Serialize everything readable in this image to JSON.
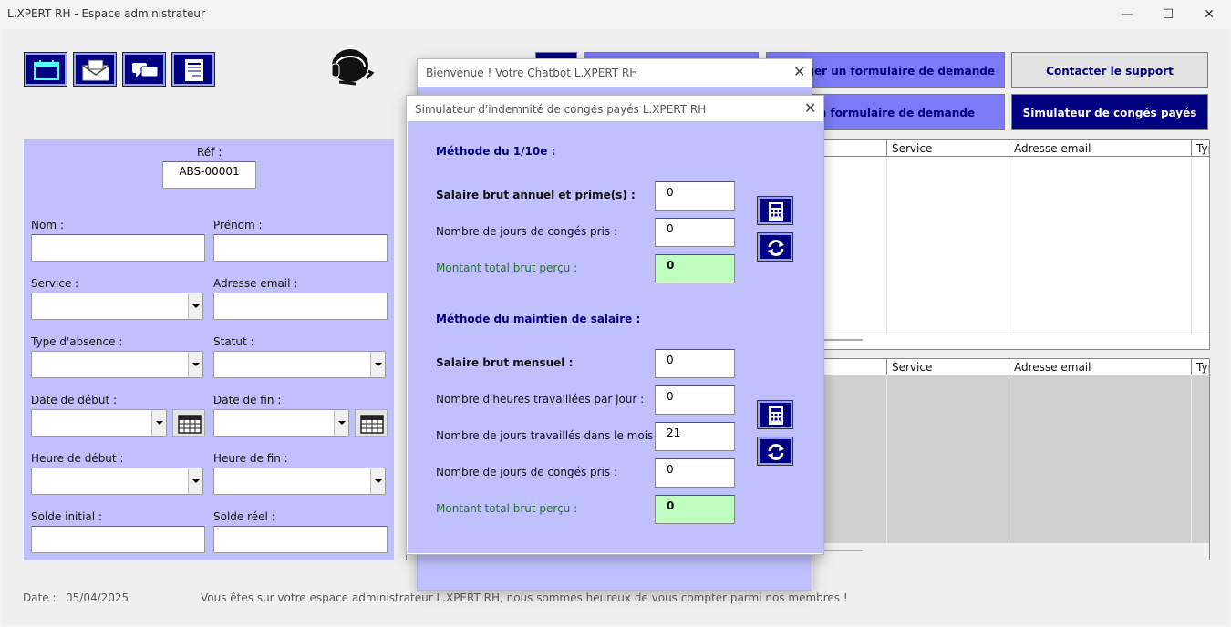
{
  "window": {
    "title": "L.XPERT RH - Espace administrateur",
    "minimize": "—",
    "maximize": "☐",
    "close": "✕"
  },
  "toolbar": {
    "icons": [
      "calendar-icon",
      "mail-icon",
      "chat-icon",
      "document-icon"
    ],
    "support_icon": "headset-icon"
  },
  "actions": {
    "download_form": "Télécharger un formulaire de demande",
    "contact_support": "Contacter le support",
    "send_form": "Envoyer un formulaire de demande",
    "simulator": "Simulateur de congés payés"
  },
  "form": {
    "ref_label": "Réf :",
    "ref_value": "ABS-00001",
    "nom_label": "Nom :",
    "prenom_label": "Prénom :",
    "service_label": "Service :",
    "email_label": "Adresse email :",
    "type_label": "Type d'absence :",
    "statut_label": "Statut :",
    "date_debut_label": "Date de début :",
    "date_fin_label": "Date de fin :",
    "heure_debut_label": "Heure de début :",
    "heure_fin_label": "Heure de fin :",
    "solde_initial_label": "Solde initial :",
    "solde_reel_label": "Solde réel :"
  },
  "grid_top": {
    "columns": [
      "Service",
      "Adresse email",
      "Typ"
    ]
  },
  "grid_bottom": {
    "columns": [
      "Service",
      "Adresse email",
      "Typ"
    ]
  },
  "chatbot": {
    "title": "Bienvenue ! Votre Chatbot L.XPERT RH"
  },
  "simulator": {
    "title": "Simulateur d'indemnité de congés payés L.XPERT RH",
    "method1_title": "Méthode du 1/10e :",
    "m1_salary_label": "Salaire brut annuel et prime(s) :",
    "m1_salary_value": "0",
    "m1_days_label": "Nombre de jours de congés pris :",
    "m1_days_value": "0",
    "m1_total_label": "Montant total brut perçu :",
    "m1_total_value": "0",
    "method2_title": "Méthode du maintien de salaire :",
    "m2_salary_label": "Salaire brut mensuel :",
    "m2_salary_value": "0",
    "m2_hours_label": "Nombre d'heures travaillées par jour :",
    "m2_hours_value": "0",
    "m2_workdays_label": "Nombre de jours travaillés dans le mois :",
    "m2_workdays_value": "21",
    "m2_days_label": "Nombre de jours de congés pris :",
    "m2_days_value": "0",
    "m2_total_label": "Montant total brut perçu :",
    "m2_total_value": "0"
  },
  "status": {
    "date_label": "Date :",
    "date_value": "05/04/2025",
    "message": "Vous êtes sur votre espace administrateur L.XPERT RH, nous sommes heureux de vous compter parmi nos membres !"
  },
  "colors": {
    "panel": "#c0c0ff",
    "navy": "#000080",
    "accent_blue": "#7b7bf7",
    "result_green": "#c0ffc0"
  }
}
